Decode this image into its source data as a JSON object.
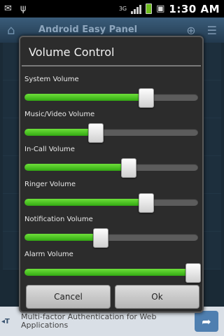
{
  "status_bar": {
    "time": "1:30 AM",
    "icons": [
      "usb-icon",
      "alert-icon",
      "signal-icon",
      "battery-icon"
    ],
    "network_label": "3G"
  },
  "background_app": {
    "title": "Android Easy Panel"
  },
  "dialog": {
    "title": "Volume Control",
    "sliders": [
      {
        "label": "System Volume",
        "level": 0.7
      },
      {
        "label": "Music/Video Volume",
        "level": 0.41
      },
      {
        "label": "In-Call Volume",
        "level": 0.6
      },
      {
        "label": "Ringer Volume",
        "level": 0.7
      },
      {
        "label": "Notification Volume",
        "level": 0.44
      },
      {
        "label": "Alarm Volume",
        "level": 1.0
      }
    ],
    "cancel_label": "Cancel",
    "ok_label": "Ok"
  },
  "ad": {
    "text": "Multi-factor Authentication for Web Applications"
  },
  "colors": {
    "slider_fill": "#4ccc24",
    "dialog_bg": "#2c2c2c",
    "appbar": "#2f4b64"
  }
}
